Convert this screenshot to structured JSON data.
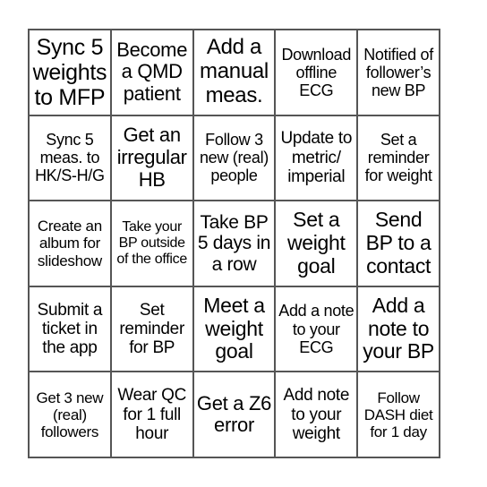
{
  "cells": [
    [
      "Sync 5 weights to MFP",
      "Become a QMD patient",
      "Add a manual meas.",
      "Download offline ECG",
      "Notified of follower’s new BP"
    ],
    [
      "Sync 5 meas. to HK/S-H/G",
      "Get an irregular HB",
      "Follow 3 new (real) people",
      "Update to metric/ imperial",
      "Set a reminder for weight"
    ],
    [
      "Create an album for slideshow",
      "Take your BP outside of the office",
      "Take BP 5 days in a row",
      "Set a weight goal",
      "Send BP to a contact"
    ],
    [
      "Submit a ticket in the app",
      "Set reminder for BP",
      "Meet a weight goal",
      "Add a note to your ECG",
      "Add a note to your BP"
    ],
    [
      "Get 3 new (real) followers",
      "Wear QC for 1 full hour",
      "Get a Z6 error",
      "Add note to your weight",
      "Follow DASH diet for 1 day"
    ]
  ],
  "colors": {
    "border": "#555555",
    "background": "#ffffff",
    "text": "#000000"
  }
}
